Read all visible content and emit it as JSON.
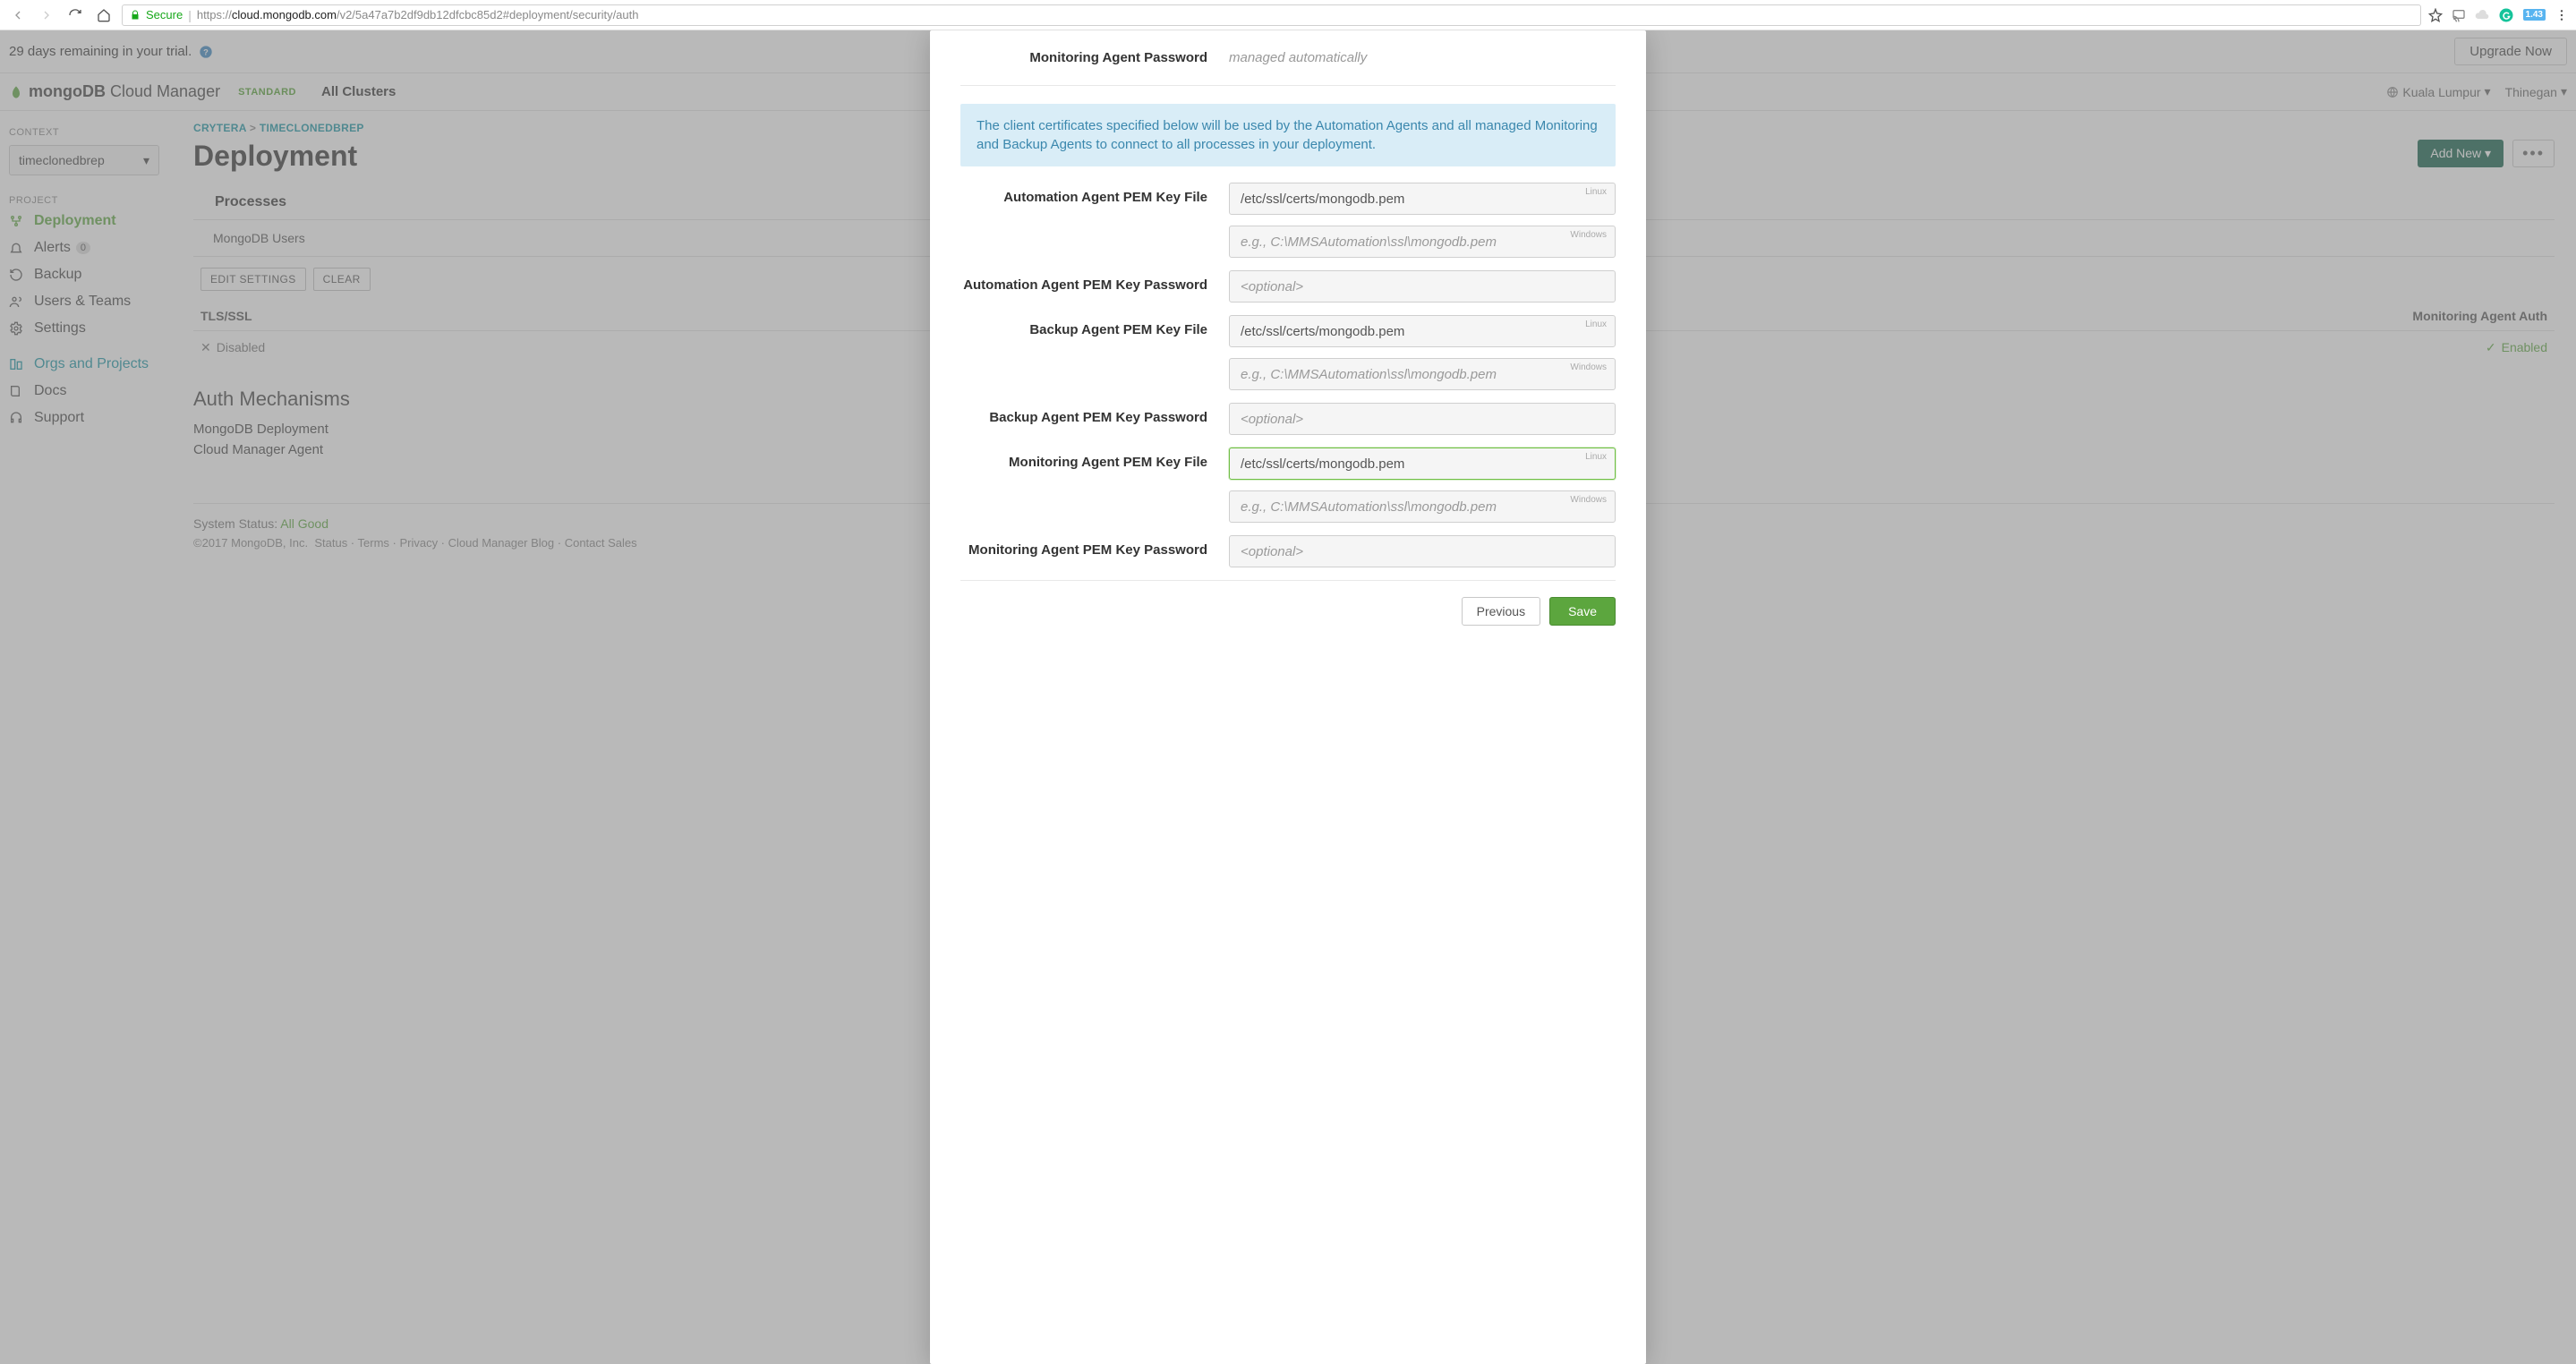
{
  "browser": {
    "secure_label": "Secure",
    "url_prefix": "https://",
    "url_host": "cloud.mongodb.com",
    "url_path": "/v2/5a47a7b2df9db12dfcbc85d2#deployment/security/auth",
    "ext_badge": "1.43"
  },
  "trial": {
    "text": "29 days remaining in your trial.",
    "upgrade_label": "Upgrade Now"
  },
  "header": {
    "logo_primary": "mongoDB",
    "logo_secondary": "Cloud Manager",
    "plan": "STANDARD",
    "nav_item": "All Clusters",
    "region": "Kuala Lumpur",
    "user": "Thinegan"
  },
  "sidebar": {
    "context_label": "CONTEXT",
    "context_value": "timeclonedbrep",
    "project_label": "PROJECT",
    "items": [
      {
        "label": "Deployment"
      },
      {
        "label": "Alerts",
        "badge": "0"
      },
      {
        "label": "Backup"
      },
      {
        "label": "Users & Teams"
      },
      {
        "label": "Settings"
      }
    ],
    "orgs_label": "Orgs and Projects",
    "docs_label": "Docs",
    "support_label": "Support"
  },
  "main": {
    "breadcrumb_1": "CRYTERA",
    "breadcrumb_sep": ">",
    "breadcrumb_2": "TIMECLONEDBREP",
    "title": "Deployment",
    "add_new": "Add New",
    "tab_processes": "Processes",
    "subtab_users": "MongoDB Users",
    "edit_settings": "EDIT SETTINGS",
    "clear_btn": "CLEAR",
    "tls_header": "TLS/SSL",
    "monitoring_header": "Monitoring Agent Auth",
    "tls_value": "Disabled",
    "monitoring_value": "Enabled",
    "mech_title": "Auth Mechanisms",
    "mech_line1": "MongoDB Deployment",
    "mech_line2": "Cloud Manager Agent",
    "footer_status_label": "System Status:",
    "footer_status_value": "All Good",
    "footer_copy": "©2017 MongoDB, Inc.",
    "footer_links": "Status · Terms · Privacy · Cloud Manager Blog · Contact Sales"
  },
  "modal": {
    "monitoring_password_label": "Monitoring Agent Password",
    "managed_text": "managed automatically",
    "info_text": "The client certificates specified below will be used by the Automation Agents and all managed Monitoring and Backup Agents to connect to all processes in your deployment.",
    "os_linux": "Linux",
    "os_windows": "Windows",
    "windows_placeholder": "e.g., C:\\MMSAutomation\\ssl\\mongodb.pem",
    "optional_placeholder": "<optional>",
    "fields": {
      "automation_pem_label": "Automation Agent PEM Key File",
      "automation_pem_value": "/etc/ssl/certs/mongodb.pem",
      "automation_pem_pw_label": "Automation Agent PEM Key Password",
      "backup_pem_label": "Backup Agent PEM Key File",
      "backup_pem_value": "/etc/ssl/certs/mongodb.pem",
      "backup_pem_pw_label": "Backup Agent PEM Key Password",
      "monitoring_pem_label": "Monitoring Agent PEM Key File",
      "monitoring_pem_value": "/etc/ssl/certs/mongodb.pem",
      "monitoring_pem_pw_label": "Monitoring Agent PEM Key Password"
    },
    "previous_label": "Previous",
    "save_label": "Save"
  }
}
